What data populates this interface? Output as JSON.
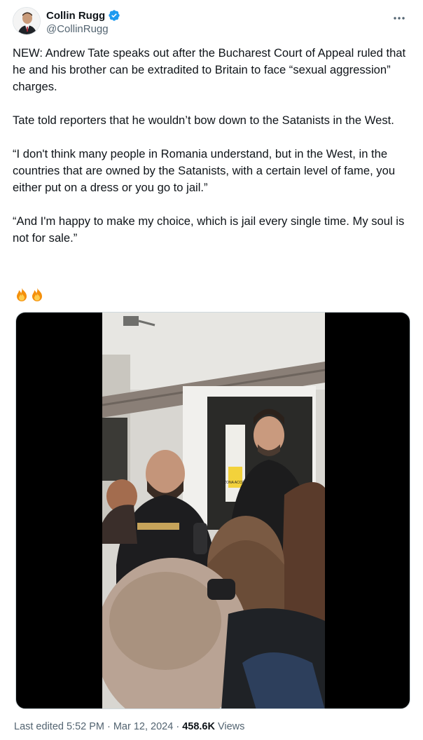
{
  "author": {
    "display_name": "Collin Rugg",
    "handle": "@CollinRugg",
    "verified": true,
    "verified_color": "#1d9bf0"
  },
  "tweet": {
    "paragraphs": [
      "NEW: Andrew Tate speaks out after the Bucharest Court of Appeal ruled that he and his brother can be extradited to Britain to face “sexual aggression” charges.",
      "Tate told reporters that he wouldn’t bow down to the Satanists in the West.",
      "“I don't think many people in Romania understand, but in the West, in the countries that are owned by the Satanists, with a certain level of fame, you either put on a dress or you go to jail.”",
      "“And I'm happy to make my choice, which is jail every single time. My soul is not for sale.”"
    ],
    "emojis": [
      "fire-icon",
      "fire-icon"
    ]
  },
  "media": {
    "type": "video",
    "zone_sign_text": "ZONA ACCES"
  },
  "footer": {
    "edited_label": "Last edited 5:52 PM · Mar 12, 2024 · ",
    "views_count": "458.6K",
    "views_label": " Views"
  },
  "colors": {
    "text": "#0f1419",
    "secondary": "#536471",
    "accent": "#1d9bf0"
  }
}
